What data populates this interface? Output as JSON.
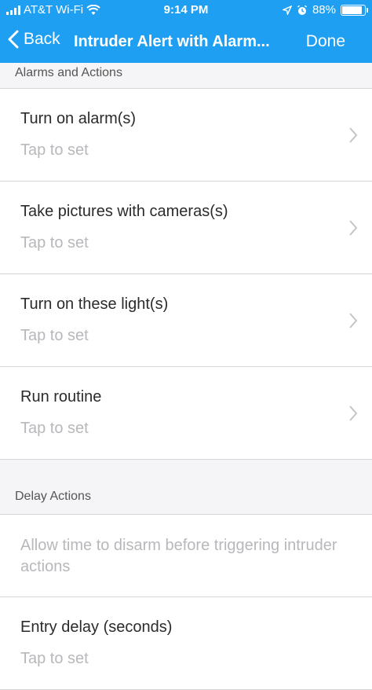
{
  "status_bar": {
    "carrier": "AT&T Wi-Fi",
    "time": "9:14 PM",
    "battery": "88%",
    "battery_level": 0.88
  },
  "nav": {
    "back_label": "Back",
    "title": "Intruder Alert with Alarm...",
    "done_label": "Done"
  },
  "sections": {
    "alarms_actions": {
      "header": "Alarms and Actions",
      "rows": [
        {
          "title": "Turn on alarm(s)",
          "subtitle": "Tap to set"
        },
        {
          "title": "Take pictures with cameras(s)",
          "subtitle": "Tap to set"
        },
        {
          "title": "Turn on these light(s)",
          "subtitle": "Tap to set"
        },
        {
          "title": "Run routine",
          "subtitle": "Tap to set"
        }
      ]
    },
    "delay_actions": {
      "header": "Delay Actions",
      "description": "Allow time to disarm before triggering intruder actions",
      "rows": [
        {
          "title": "Entry delay (seconds)",
          "subtitle": "Tap to set"
        }
      ]
    }
  },
  "colors": {
    "header_bg": "#1e9ff2",
    "background": "#f5f5f7",
    "subtitle_text": "#b8b8bc"
  }
}
